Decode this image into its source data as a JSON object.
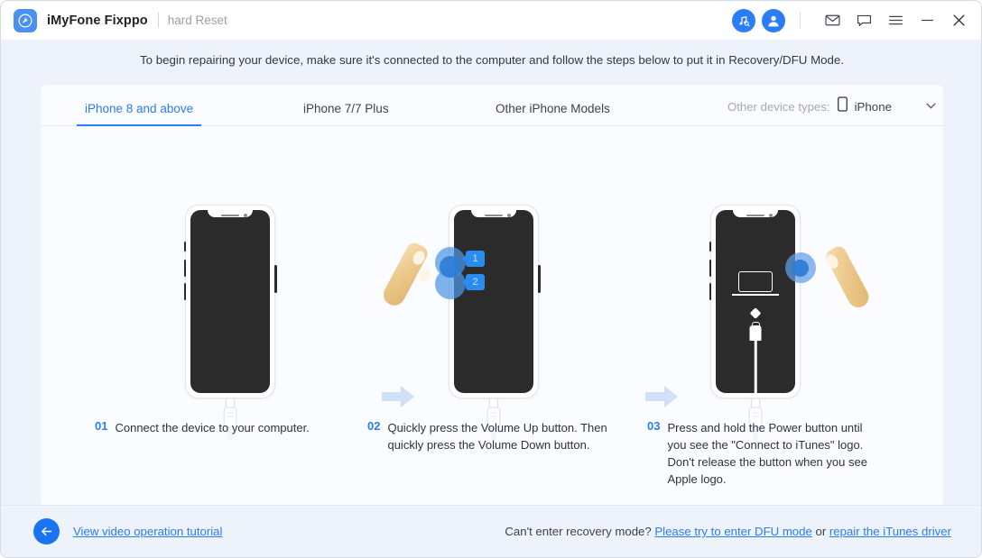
{
  "titlebar": {
    "logo_icon": "wrench-circle-icon",
    "app_name": "iMyFone Fixppo",
    "mode_label": "hard Reset",
    "icons": [
      {
        "name": "itunes-repair-icon",
        "glyph": "music-search"
      },
      {
        "name": "account-avatar-icon",
        "glyph": "person"
      },
      {
        "name": "mail-icon",
        "glyph": "envelope"
      },
      {
        "name": "feedback-icon",
        "glyph": "chat-bubble"
      },
      {
        "name": "menu-icon",
        "glyph": "hamburger"
      },
      {
        "name": "minimize-icon",
        "glyph": "minus"
      },
      {
        "name": "close-icon",
        "glyph": "cross"
      }
    ]
  },
  "banner": {
    "text": "To begin repairing your device, make sure it's connected to the computer and follow the steps below to put it in Recovery/DFU Mode."
  },
  "tabs": [
    {
      "label": "iPhone 8 and above",
      "active": true
    },
    {
      "label": "iPhone 7/7 Plus",
      "active": false
    },
    {
      "label": "Other iPhone Models",
      "active": false
    }
  ],
  "device_selector": {
    "label": "Other device types:",
    "icon": "phone-icon",
    "value": "iPhone",
    "chevron": "chevron-down-icon"
  },
  "steps": [
    {
      "num": "01",
      "text": "Connect the device to your computer.",
      "illustration": "iphone-connected"
    },
    {
      "num": "02",
      "text": "Quickly press the Volume Up button. Then quickly press the Volume Down button.",
      "illustration": "iphone-volume-press",
      "badges": [
        "1",
        "2"
      ]
    },
    {
      "num": "03",
      "text": "Press and hold the Power button until you see the \"Connect to iTunes\" logo. Don't release the button when you see Apple logo.",
      "illustration": "iphone-recovery-screen"
    }
  ],
  "footer": {
    "back_icon": "arrow-left-icon",
    "video_link": "View video operation tutorial",
    "help_prefix": "Can't enter recovery mode? ",
    "dfu_link": "Please try to enter DFU mode",
    "help_middle": " or ",
    "driver_link": "repair the iTunes driver"
  },
  "colors": {
    "accent": "#2a7cf7",
    "page_bg": "#eef2fa",
    "panel_bg": "#fafcff",
    "badge": "#2b8cf0",
    "arrow": "#cfe0f7"
  }
}
